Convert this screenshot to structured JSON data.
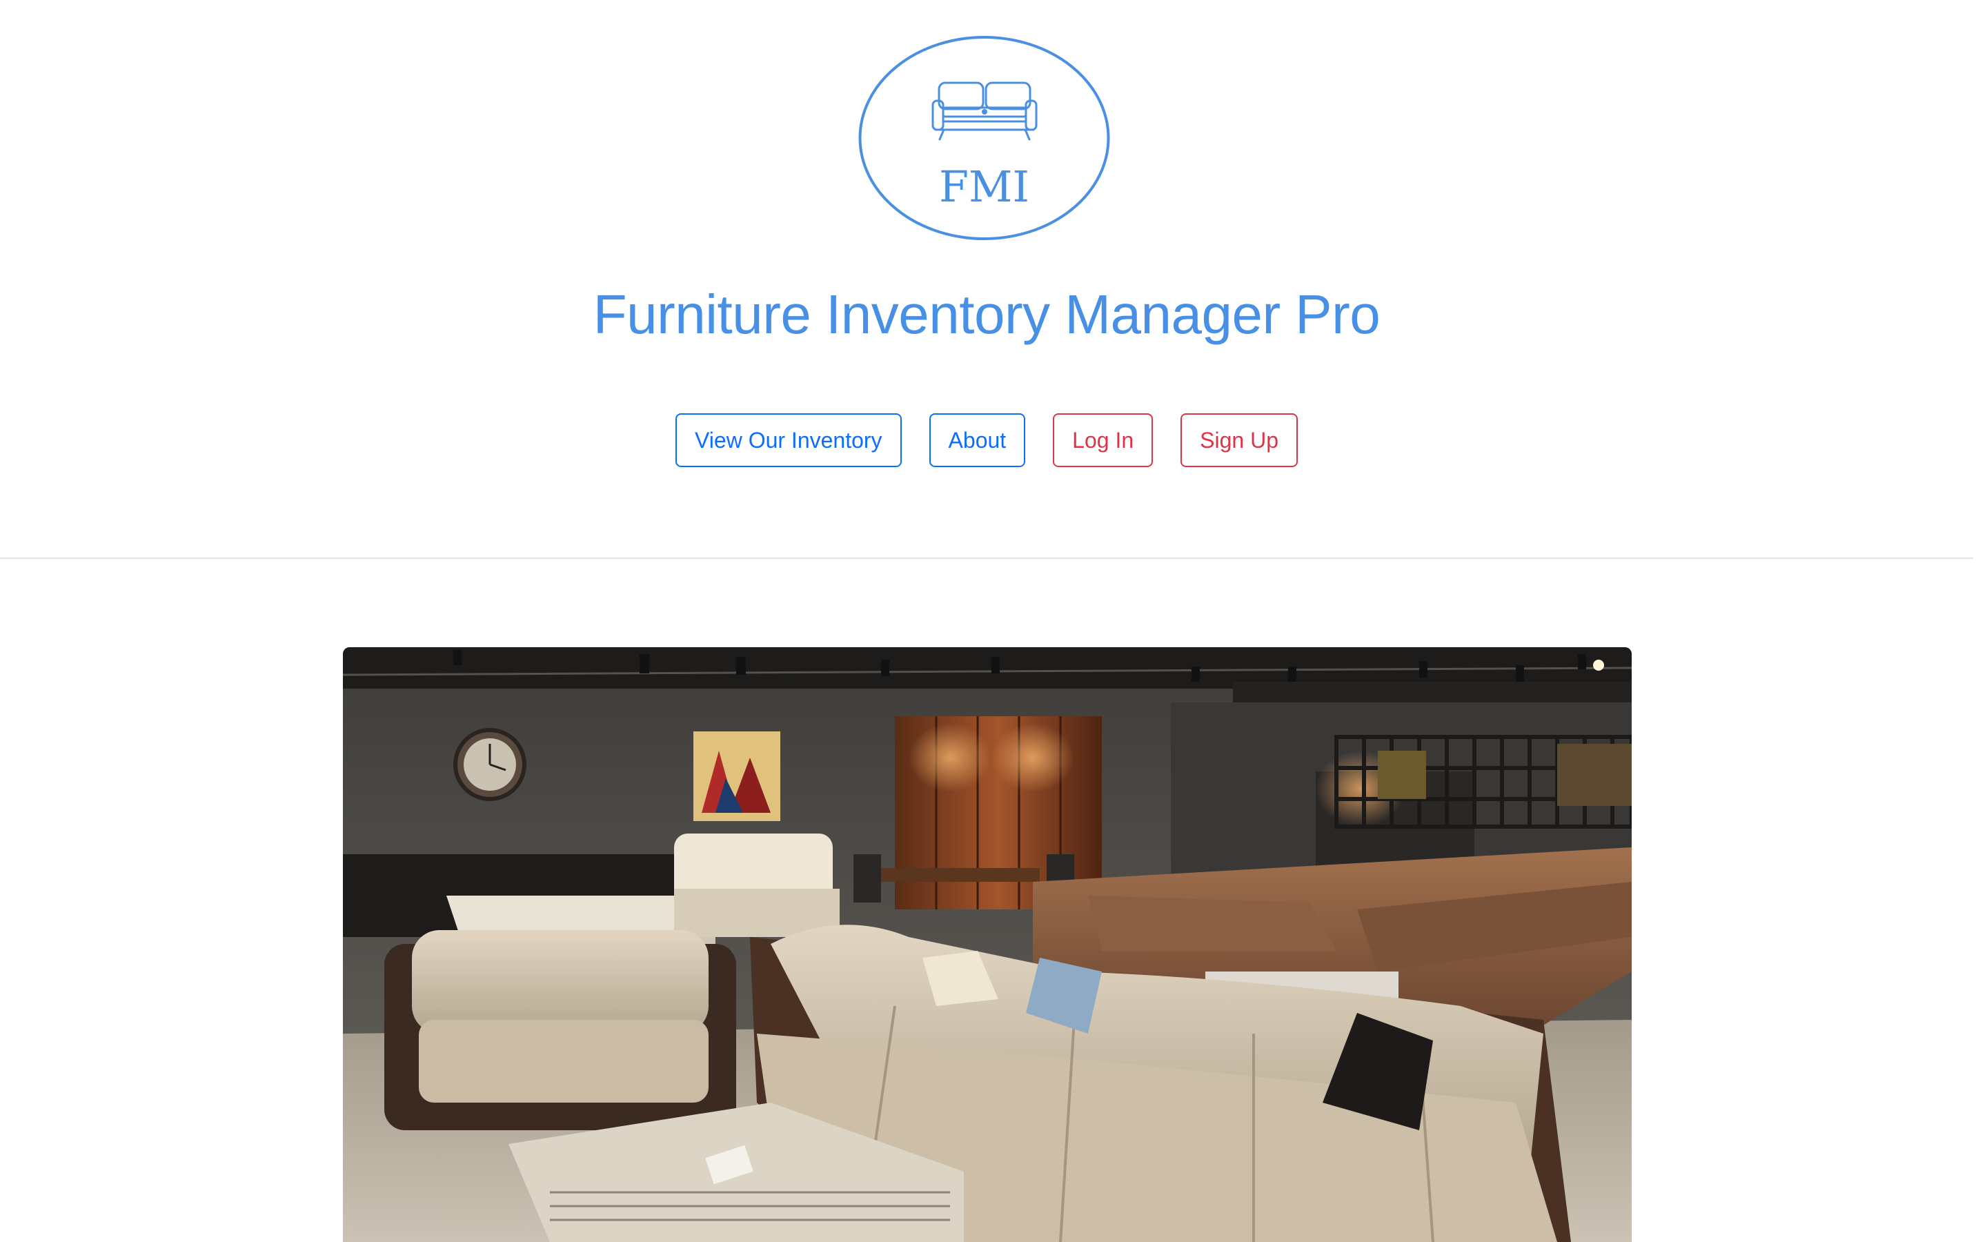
{
  "brand": {
    "logo_text": "FMI",
    "logo_icon": "sofa-icon",
    "title": "Furniture Inventory Manager Pro",
    "accent_color": "#4790e6"
  },
  "nav": {
    "inventory_label": "View Our Inventory",
    "about_label": "About",
    "login_label": "Log In",
    "signup_label": "Sign Up",
    "primary_color": "#0d6efd",
    "danger_color": "#dc3545"
  },
  "hero": {
    "image_subject": "furniture-showroom-photo"
  }
}
